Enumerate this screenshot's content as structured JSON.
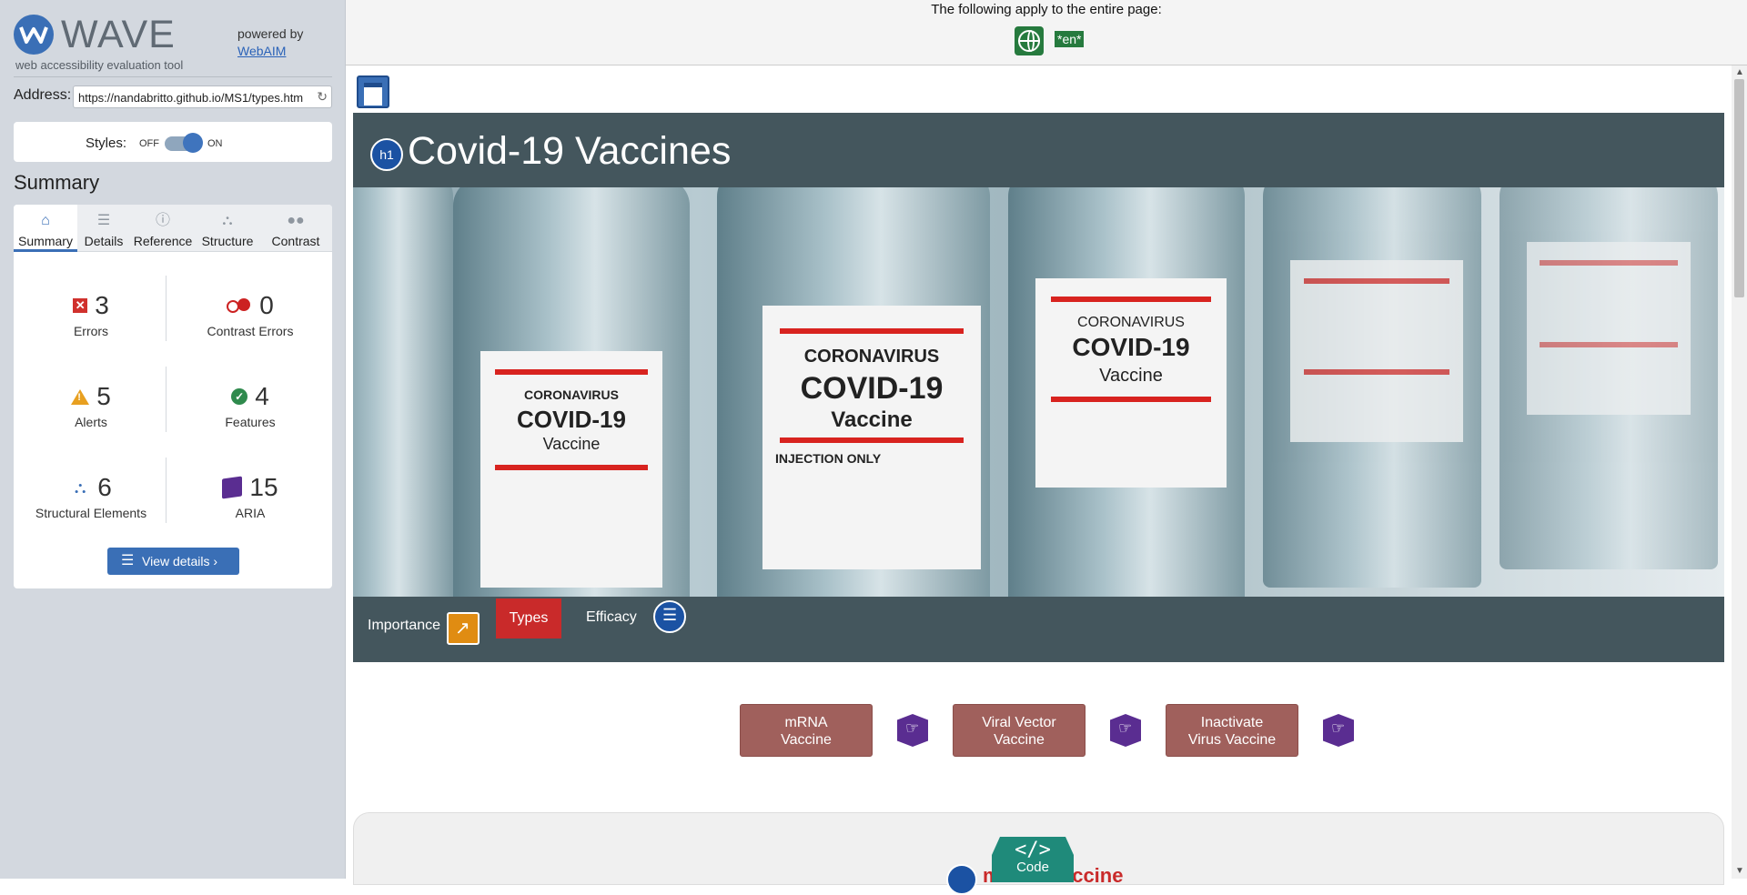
{
  "wave": {
    "logo_word": "WAVE",
    "logo_sub": "web accessibility evaluation tool",
    "powered_by": "powered by",
    "webaim": "WebAIM",
    "address_label": "Address:",
    "address_value": "https://nandabritto.github.io/MS1/types.htm",
    "styles_label": "Styles:",
    "styles_off": "OFF",
    "styles_on": "ON",
    "summary_title": "Summary",
    "tabs": [
      {
        "label": "Summary",
        "icon": "home-icon"
      },
      {
        "label": "Details",
        "icon": "list-icon"
      },
      {
        "label": "Reference",
        "icon": "info-icon"
      },
      {
        "label": "Structure",
        "icon": "structure-icon"
      },
      {
        "label": "Contrast",
        "icon": "contrast-icon"
      }
    ],
    "stats": {
      "errors": {
        "count": "3",
        "label": "Errors"
      },
      "contrast": {
        "count": "0",
        "label": "Contrast Errors"
      },
      "alerts": {
        "count": "5",
        "label": "Alerts"
      },
      "features": {
        "count": "4",
        "label": "Features"
      },
      "structural": {
        "count": "6",
        "label": "Structural Elements"
      },
      "aria": {
        "count": "15",
        "label": "ARIA"
      }
    },
    "view_details": "View details ›"
  },
  "page": {
    "top_notice": "The following apply to the entire page:",
    "lang_badge": "*en*",
    "hero_title": "Covid-19 Vaccines",
    "h1_badge": "h1",
    "vial_text": {
      "line1": "CORONAVIRUS",
      "line2": "COVID-19",
      "line3": "Vaccine",
      "line4": "INJECTION ONLY"
    },
    "nav": {
      "importance": "Importance",
      "types": "Types",
      "efficacy": "Efficacy"
    },
    "cards": [
      {
        "line1": "mRNA",
        "line2": "Vaccine"
      },
      {
        "line1": "Viral Vector",
        "line2": "Vaccine"
      },
      {
        "line1": "Inactivate",
        "line2": "Virus Vaccine"
      }
    ],
    "code_badge": {
      "symbol": "</>",
      "label": "Code"
    },
    "section_heading_peek": "mRNA Vaccine"
  },
  "colors": {
    "accent": "#3a6fb6",
    "hero_bg": "#44565d",
    "types_red": "#c92a2a",
    "card_brown": "#a0605c"
  }
}
